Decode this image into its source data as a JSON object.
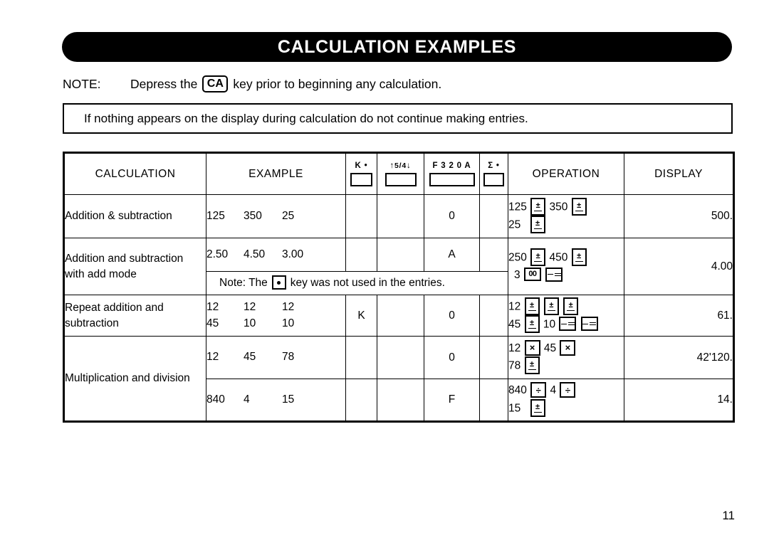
{
  "page": {
    "title": "CALCULATION EXAMPLES",
    "page_number": "11"
  },
  "note": {
    "label": "NOTE:",
    "text_before": "Depress the",
    "key": "CA",
    "text_after": "key prior to beginning any calculation."
  },
  "warning": {
    "text": "If nothing appears on the display during calculation do not continue making entries."
  },
  "table": {
    "headers": {
      "calculation": "CALCULATION",
      "example": "EXAMPLE",
      "operation": "OPERATION",
      "display": "DISPLAY",
      "switches": [
        {
          "name": "k-switch",
          "label": "K •"
        },
        {
          "name": "rounding-switch",
          "label_up": "↑",
          "label_frac": "5/4",
          "label_down": "↓"
        },
        {
          "name": "decimal-switch",
          "label": "F 3 2 0 A"
        },
        {
          "name": "grand-total-switch",
          "label": "Σ •"
        }
      ]
    },
    "rows": [
      {
        "calculation": "Addition & subtraction",
        "example_numbers": [
          "125",
          "350",
          "25"
        ],
        "k_switch": "",
        "rounding_switch": "",
        "decimal_switch": "0",
        "sigma_switch": "",
        "operation_line1": {
          "entries": [
            "125",
            "350"
          ],
          "keys": [
            "plus-equals",
            "plus-equals"
          ]
        },
        "operation_line2": {
          "entries": [
            "25"
          ],
          "keys": [
            "plus-equals"
          ]
        },
        "display": "500."
      },
      {
        "calculation": "Addition and subtraction with add mode",
        "example_numbers": [
          "2.50",
          "4.50",
          "3.00"
        ],
        "example_note_before": "Note:  The",
        "example_note_key": "decimal-point",
        "example_note_after": "key was not used in the entries.",
        "k_switch": "",
        "rounding_switch": "",
        "decimal_switch": "A",
        "sigma_switch": "",
        "operation_line1": {
          "entries": [
            "250",
            "450"
          ],
          "keys": [
            "plus-equals",
            "plus-equals"
          ]
        },
        "operation_line2": {
          "entries": [
            "3"
          ],
          "keys": [
            "double-zero",
            "minus-equals"
          ]
        },
        "display": "4.00"
      },
      {
        "calculation": "Repeat addition and subtraction",
        "example_numbers_row1": [
          "12",
          "12",
          "12"
        ],
        "example_numbers_row2": [
          "45",
          "10",
          "10"
        ],
        "k_switch": "K",
        "rounding_switch": "",
        "decimal_switch": "0",
        "sigma_switch": "",
        "operation_line1": {
          "entries": [
            "12"
          ],
          "keys": [
            "plus-equals",
            "plus-equals",
            "plus-equals"
          ]
        },
        "operation_line2": {
          "entries": [
            "45",
            "10"
          ],
          "keys": [
            "plus-equals",
            "minus-equals",
            "minus-equals"
          ]
        },
        "display": "61."
      },
      {
        "calculation": "Multiplication and division",
        "example_numbers": [
          "12",
          "45",
          "78"
        ],
        "k_switch": "",
        "rounding_switch": "",
        "decimal_switch": "0",
        "sigma_switch": "",
        "operation_line1": {
          "entries": [
            "12",
            "45"
          ],
          "keys": [
            "multiply",
            "multiply"
          ]
        },
        "operation_line2": {
          "entries": [
            "78"
          ],
          "keys": [
            "plus-equals"
          ]
        },
        "display": "42'120."
      },
      {
        "calculation": "",
        "example_numbers": [
          "840",
          "4",
          "15"
        ],
        "k_switch": "",
        "rounding_switch": "",
        "decimal_switch": "F",
        "sigma_switch": "",
        "operation_line1": {
          "entries": [
            "840",
            "4"
          ],
          "keys": [
            "divide",
            "divide"
          ]
        },
        "operation_line2": {
          "entries": [
            "15"
          ],
          "keys": [
            "plus-equals"
          ]
        },
        "display": "14."
      }
    ]
  },
  "colors": {
    "banner_background": "#000000",
    "banner_text": "#ffffff",
    "page_background": "#ffffff",
    "rule": "#000000"
  }
}
